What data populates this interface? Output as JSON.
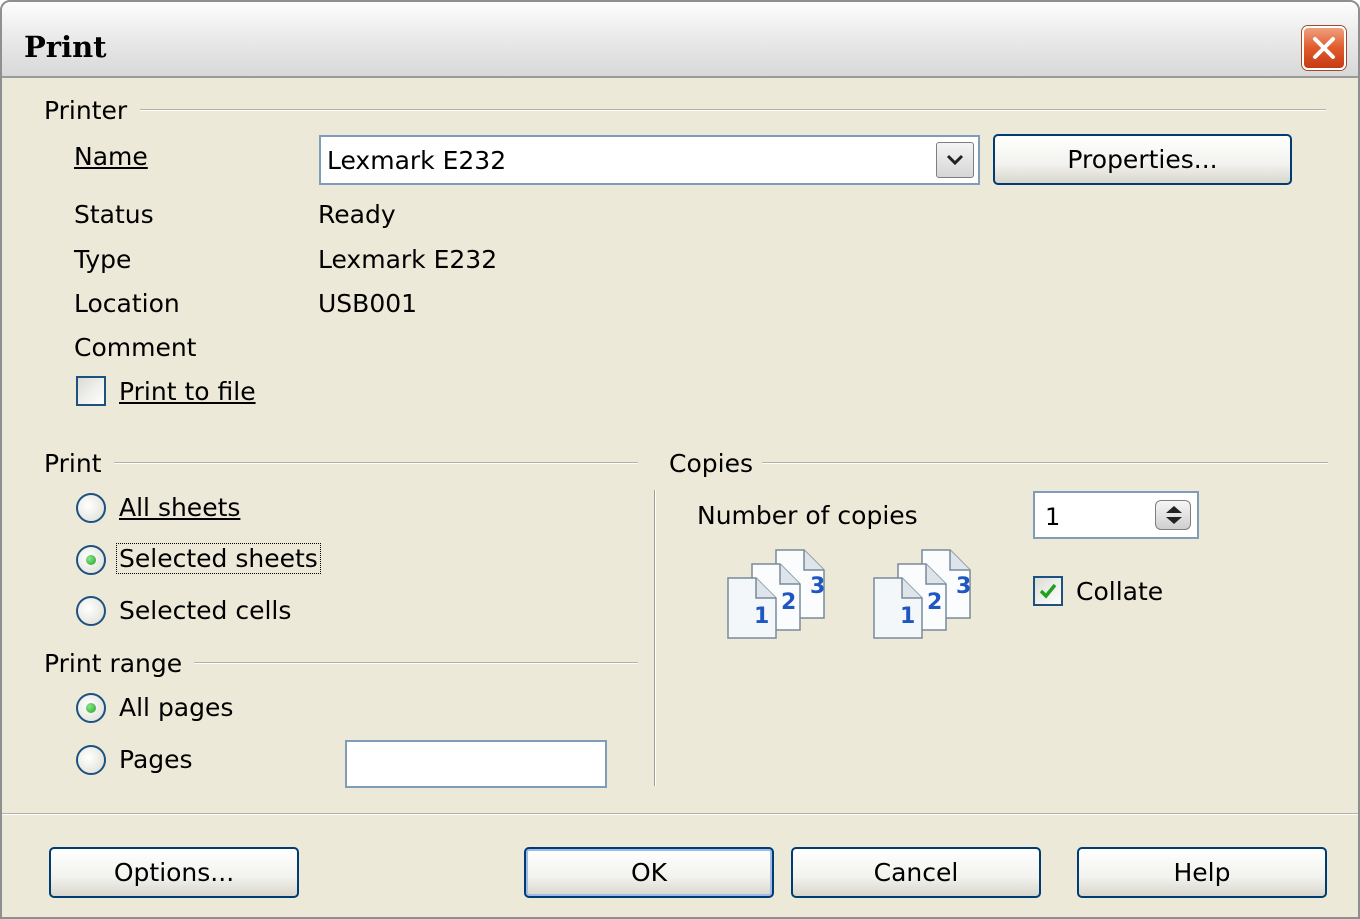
{
  "window": {
    "title": "Print"
  },
  "printer": {
    "group_label": "Printer",
    "name_label": "Name",
    "name_value": "Lexmark E232",
    "properties_button": "Properties...",
    "status_label": "Status",
    "status_value": "Ready",
    "type_label": "Type",
    "type_value": "Lexmark E232",
    "location_label": "Location",
    "location_value": "USB001",
    "comment_label": "Comment",
    "comment_value": "",
    "print_to_file_label": "Print to file",
    "print_to_file_checked": false
  },
  "print": {
    "group_label": "Print",
    "options": [
      {
        "label": "All sheets",
        "checked": false
      },
      {
        "label": "Selected sheets",
        "checked": true
      },
      {
        "label": "Selected cells",
        "checked": false
      }
    ]
  },
  "print_range": {
    "group_label": "Print range",
    "all_pages_label": "All pages",
    "all_pages_checked": true,
    "pages_label": "Pages",
    "pages_checked": false,
    "pages_value": ""
  },
  "copies": {
    "group_label": "Copies",
    "number_label": "Number of copies",
    "number_value": "1",
    "collate_label": "Collate",
    "collate_checked": true,
    "page_numbers": [
      "1",
      "2",
      "3"
    ]
  },
  "buttons": {
    "options": "Options...",
    "ok": "OK",
    "cancel": "Cancel",
    "help": "Help"
  },
  "colors": {
    "dialog_bg": "#ece9d8",
    "button_border": "#003c74",
    "check_green": "#21a121",
    "close_red": "#e05a2c"
  },
  "icons": {
    "close": "close-x-icon",
    "dropdown": "chevron-down-icon",
    "spin": "spin-updown-icon",
    "collate": "collate-pages-icon",
    "check": "checkmark-icon"
  }
}
